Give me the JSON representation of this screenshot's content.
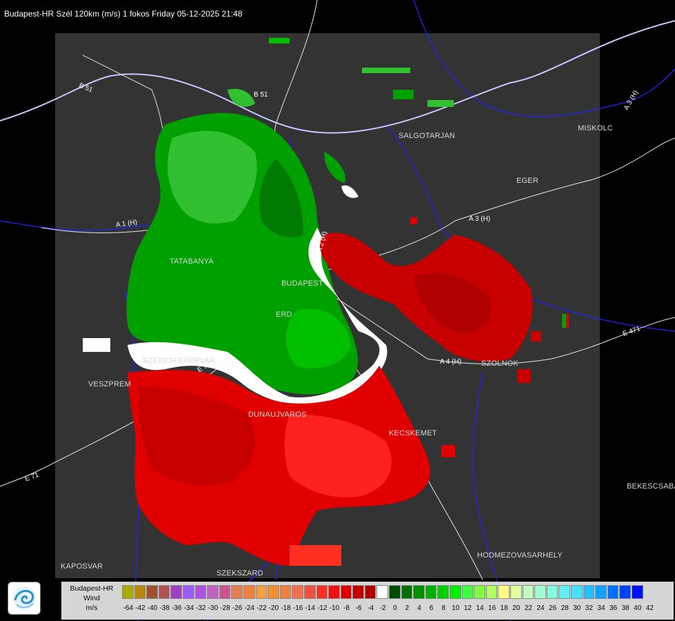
{
  "header": {
    "title": "Budapest-HR Szél 120km (m/s) 1 fokos Friday 05-12-2025 21:48"
  },
  "cities": [
    {
      "name": "SALGOTARJAN"
    },
    {
      "name": "MISKOLC"
    },
    {
      "name": "EGER"
    },
    {
      "name": "TATABANYA"
    },
    {
      "name": "BUDAPEST"
    },
    {
      "name": "ERD"
    },
    {
      "name": "SZEKESFEHERVAR"
    },
    {
      "name": "VESZPREM"
    },
    {
      "name": "DUNAUJVAROS"
    },
    {
      "name": "KECSKEMET"
    },
    {
      "name": "SZOLNOK"
    },
    {
      "name": "BEKESCSABA"
    },
    {
      "name": "HODMEZOVASARHELY"
    },
    {
      "name": "KAPOSVAR"
    },
    {
      "name": "SZEKSZARD"
    }
  ],
  "roads": [
    {
      "name": "B 51"
    },
    {
      "name": "B 51"
    },
    {
      "name": "A 3 (H)"
    },
    {
      "name": "A 3 (H)"
    },
    {
      "name": "A 1 (H)"
    },
    {
      "name": "A 2 (H)"
    },
    {
      "name": "E 71"
    },
    {
      "name": "E 71"
    },
    {
      "name": "A 4 (H)"
    },
    {
      "name": "E 471"
    }
  ],
  "legend": {
    "station": "Budapest-HR",
    "quantity": "Wind",
    "unit": "m/s",
    "bins": [
      {
        "label": "-64",
        "color": "#aaaa00"
      },
      {
        "label": "-42",
        "color": "#b8860b"
      },
      {
        "label": "-40",
        "color": "#a0522d"
      },
      {
        "label": "-38",
        "color": "#b05050"
      },
      {
        "label": "-36",
        "color": "#a040c0"
      },
      {
        "label": "-34",
        "color": "#9b59ff"
      },
      {
        "label": "-32",
        "color": "#b050e0"
      },
      {
        "label": "-30",
        "color": "#c060c0"
      },
      {
        "label": "-28",
        "color": "#d05090"
      },
      {
        "label": "-26",
        "color": "#e08050"
      },
      {
        "label": "-24",
        "color": "#f08040"
      },
      {
        "label": "-22",
        "color": "#f5a040"
      },
      {
        "label": "-20",
        "color": "#f09030"
      },
      {
        "label": "-18",
        "color": "#f08040"
      },
      {
        "label": "-16",
        "color": "#f07050"
      },
      {
        "label": "-14",
        "color": "#f05040"
      },
      {
        "label": "-12",
        "color": "#ff3020"
      },
      {
        "label": "-10",
        "color": "#f01010"
      },
      {
        "label": "-8",
        "color": "#e00000"
      },
      {
        "label": "-6",
        "color": "#c80000"
      },
      {
        "label": "-4",
        "color": "#b00000"
      },
      {
        "label": "-2",
        "color": "#ffffff"
      },
      {
        "label": "0",
        "color": "#004d00"
      },
      {
        "label": "2",
        "color": "#007000"
      },
      {
        "label": "4",
        "color": "#009000"
      },
      {
        "label": "6",
        "color": "#00b000"
      },
      {
        "label": "8",
        "color": "#00d000"
      },
      {
        "label": "10",
        "color": "#00ee00"
      },
      {
        "label": "12",
        "color": "#40ff40"
      },
      {
        "label": "14",
        "color": "#80ff40"
      },
      {
        "label": "16",
        "color": "#b0ff60"
      },
      {
        "label": "18",
        "color": "#ffff80"
      },
      {
        "label": "20",
        "color": "#e0ffa0"
      },
      {
        "label": "22",
        "color": "#c0ffc0"
      },
      {
        "label": "24",
        "color": "#a0ffd0"
      },
      {
        "label": "26",
        "color": "#80ffe0"
      },
      {
        "label": "28",
        "color": "#60f0f0"
      },
      {
        "label": "30",
        "color": "#40e0ff"
      },
      {
        "label": "32",
        "color": "#20c0ff"
      },
      {
        "label": "34",
        "color": "#10a0ff"
      },
      {
        "label": "36",
        "color": "#0070ff"
      },
      {
        "label": "38",
        "color": "#0040ff"
      },
      {
        "label": "40",
        "color": "#0010ff"
      },
      {
        "label": "42",
        "color": ""
      }
    ]
  },
  "colors": {
    "background": "#000000",
    "radar_area": "#333333",
    "rivers": "#1a1aff",
    "roads": "#ffffff",
    "outbound": "#00b000",
    "inbound": "#e00000"
  }
}
